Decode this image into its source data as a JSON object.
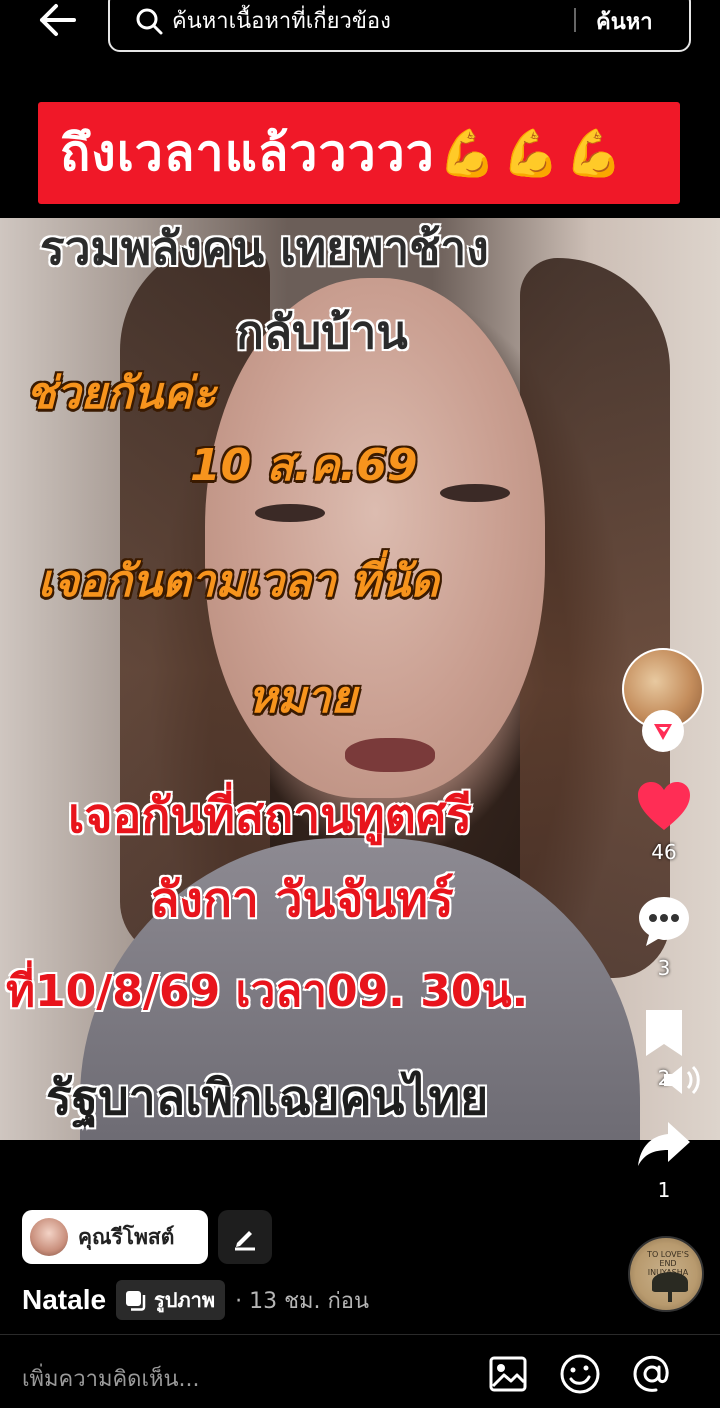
{
  "search": {
    "placeholder": "ค้นหาเนื้อหาที่เกี่ยวข้อง",
    "button_label": "ค้นหา"
  },
  "banner": {
    "text": "ถึงเวลาแล้ววววว",
    "emoji": "💪💪💪"
  },
  "video": {
    "overlay_lines": [
      "รวมพลังคน เทยพาช้าง",
      "กลับบ้าน",
      "ช่วยกันค่ะ",
      "10 ส.ค.69",
      "เจอกันตามเวลา ที่นัด",
      "หมาย",
      "เจอกันที่สถานทูตศรี",
      "ลังกา วันจันทร์",
      "ที่10/8/69 เวลา09. 30น.",
      "รัฐบาลเพิกเฉยคนไทย"
    ]
  },
  "rail": {
    "like_count": "46",
    "comment_count": "3",
    "bookmark_count": "2",
    "share_count": "1"
  },
  "post": {
    "chip_label": "คุณรีโพสต์",
    "author": "Natale",
    "type_label": "รูปภาพ",
    "time": "· 13 ชม. ก่อน",
    "music_disc_text": "TO LOVE'S END INUYASHA"
  },
  "comment": {
    "placeholder": "เพิ่มความคิดเห็น..."
  },
  "icons": {
    "back": "arrow-left-icon",
    "search": "search-icon",
    "heart": "heart-icon",
    "comment": "comment-icon",
    "bookmark": "bookmark-icon",
    "share": "share-icon",
    "edit": "pencil-icon",
    "image": "image-icon",
    "emoji": "emoji-icon",
    "mention": "at-icon"
  },
  "colors": {
    "banner_red": "#f01828",
    "like_red": "#ff2d55",
    "overlay_orange": "#f7941d"
  }
}
